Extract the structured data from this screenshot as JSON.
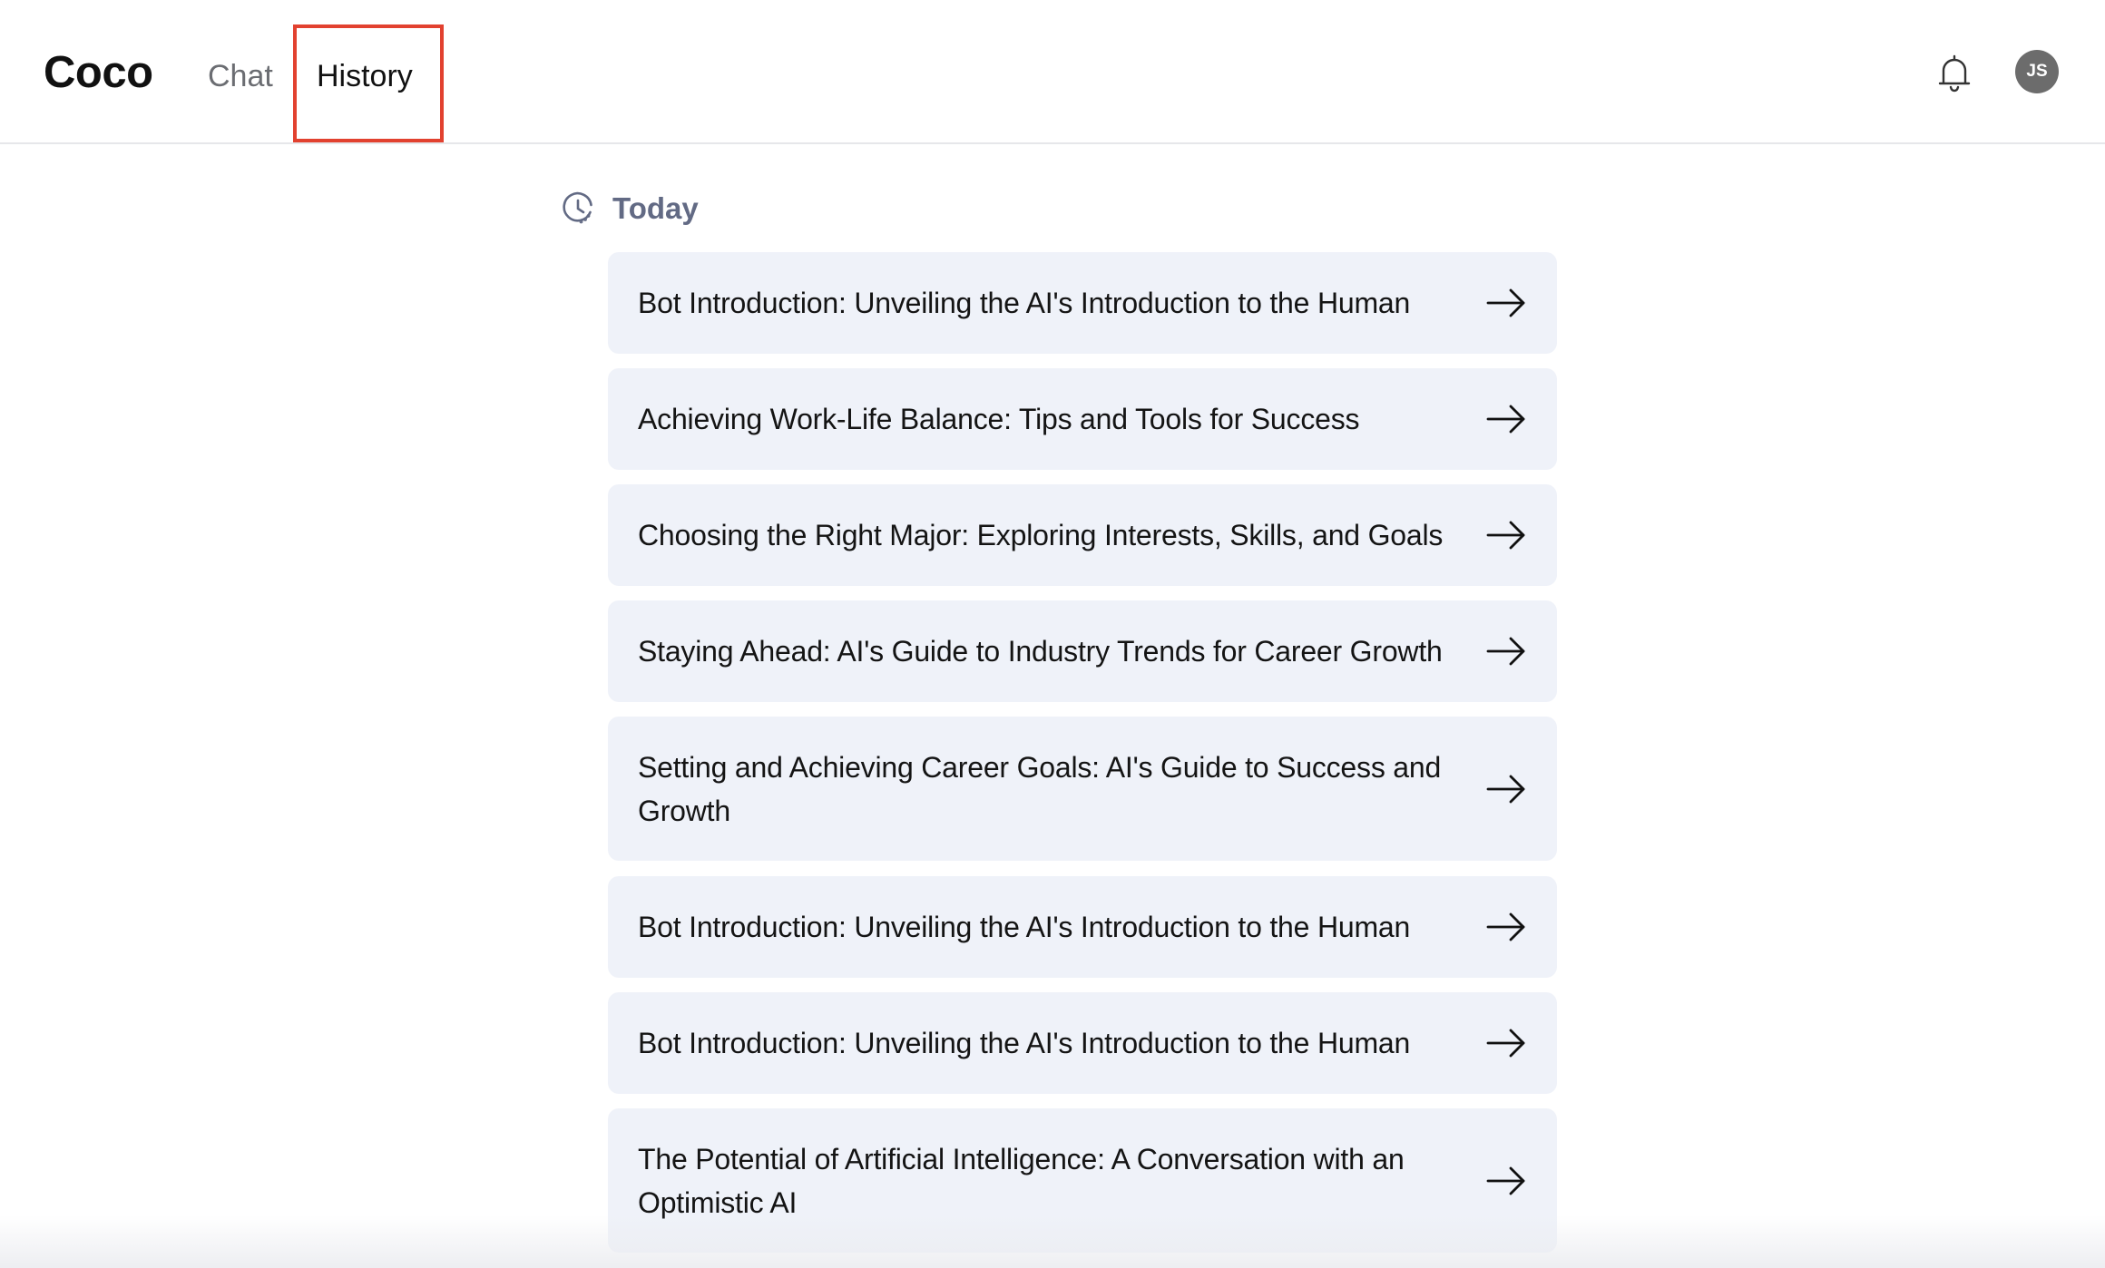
{
  "app": {
    "logo": "Coco"
  },
  "nav": {
    "tabs": [
      {
        "label": "Chat",
        "active": false
      },
      {
        "label": "History",
        "active": true
      }
    ]
  },
  "header": {
    "bell_icon": "bell-icon",
    "avatar_initials": "JS",
    "avatar_color": "#6c6c6c"
  },
  "section": {
    "icon": "clock-history-icon",
    "title": "Today"
  },
  "history_items": [
    {
      "title": "Bot Introduction: Unveiling the AI's Introduction to the Human"
    },
    {
      "title": "Achieving Work-Life Balance: Tips and Tools for Success"
    },
    {
      "title": "Choosing the Right Major: Exploring Interests, Skills, and Goals"
    },
    {
      "title": "Staying Ahead: AI's Guide to Industry Trends for Career Growth"
    },
    {
      "title": "Setting and Achieving Career Goals: AI's Guide to Success and Growth"
    },
    {
      "title": "Bot Introduction: Unveiling the AI's Introduction to the Human"
    },
    {
      "title": "Bot Introduction: Unveiling the AI's Introduction to the Human"
    },
    {
      "title": "The Potential of Artificial Intelligence: A Conversation with an Optimistic AI"
    }
  ],
  "colors": {
    "accent_highlight": "#e2412f",
    "item_background": "#eff2f9",
    "section_title": "#626a84"
  }
}
